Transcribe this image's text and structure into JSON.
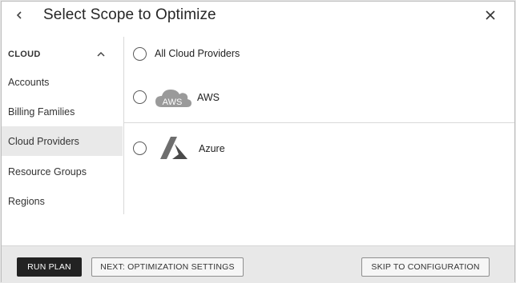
{
  "header": {
    "title": "Select Scope to Optimize"
  },
  "sidebar": {
    "section_label": "CLOUD",
    "items": [
      {
        "label": "Accounts"
      },
      {
        "label": "Billing Families"
      },
      {
        "label": "Cloud Providers",
        "active": true
      },
      {
        "label": "Resource Groups"
      },
      {
        "label": "Regions"
      }
    ]
  },
  "options": [
    {
      "label": "All Cloud Providers",
      "icon": "none"
    },
    {
      "label": "AWS",
      "icon": "aws-cloud-icon",
      "badge": "AWS"
    },
    {
      "label": "Azure",
      "icon": "azure-logo-icon"
    }
  ],
  "footer": {
    "run_plan": "RUN PLAN",
    "next": "NEXT: OPTIMIZATION SETTINGS",
    "skip": "SKIP TO CONFIGURATION"
  },
  "colors": {
    "primary_button": "#222222",
    "footer_bg": "#e8e8e8",
    "active_item_bg": "#e9e9e9"
  }
}
